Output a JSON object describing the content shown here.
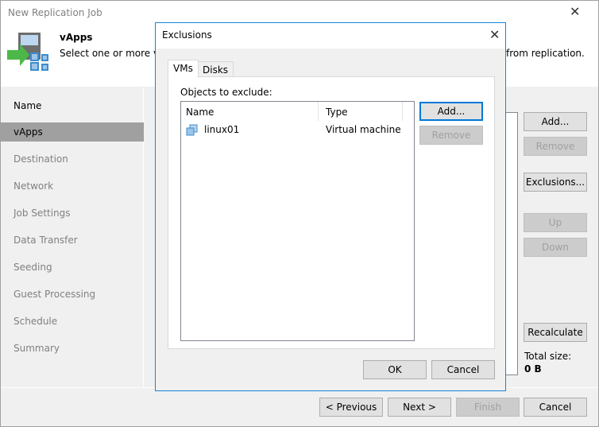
{
  "window": {
    "title": "New Replication Job",
    "close_icon": "close-icon"
  },
  "header": {
    "title": "vApps",
    "description": "Select one or more vApps to replicate. You can exclude specific VMs and disks from replication.",
    "visible_left": "Select one or more vAp",
    "visible_right": "from replication."
  },
  "nav": {
    "items": [
      {
        "label": "Name"
      },
      {
        "label": "vApps",
        "selected": true
      },
      {
        "label": "Destination"
      },
      {
        "label": "Network"
      },
      {
        "label": "Job Settings"
      },
      {
        "label": "Data Transfer"
      },
      {
        "label": "Seeding"
      },
      {
        "label": "Guest Processing"
      },
      {
        "label": "Schedule"
      },
      {
        "label": "Summary"
      }
    ]
  },
  "side_buttons": {
    "add": "Add...",
    "remove": "Remove",
    "exclusions": "Exclusions...",
    "up": "Up",
    "down": "Down",
    "recalculate": "Recalculate"
  },
  "total": {
    "label": "Total size:",
    "value": "0 B"
  },
  "footer": {
    "previous": "< Previous",
    "next": "Next >",
    "finish": "Finish",
    "cancel": "Cancel"
  },
  "dialog": {
    "title": "Exclusions",
    "tabs": [
      "VMs",
      "Disks"
    ],
    "objects_label": "Objects to exclude:",
    "columns": [
      "Name",
      "Type"
    ],
    "rows": [
      {
        "name": "linux01",
        "type": "Virtual machine",
        "icon": "vm-icon"
      }
    ],
    "add": "Add...",
    "remove": "Remove",
    "ok": "OK",
    "cancel": "Cancel"
  },
  "colors": {
    "accent": "#0078d7",
    "selected_nav": "#a0a0a0"
  }
}
